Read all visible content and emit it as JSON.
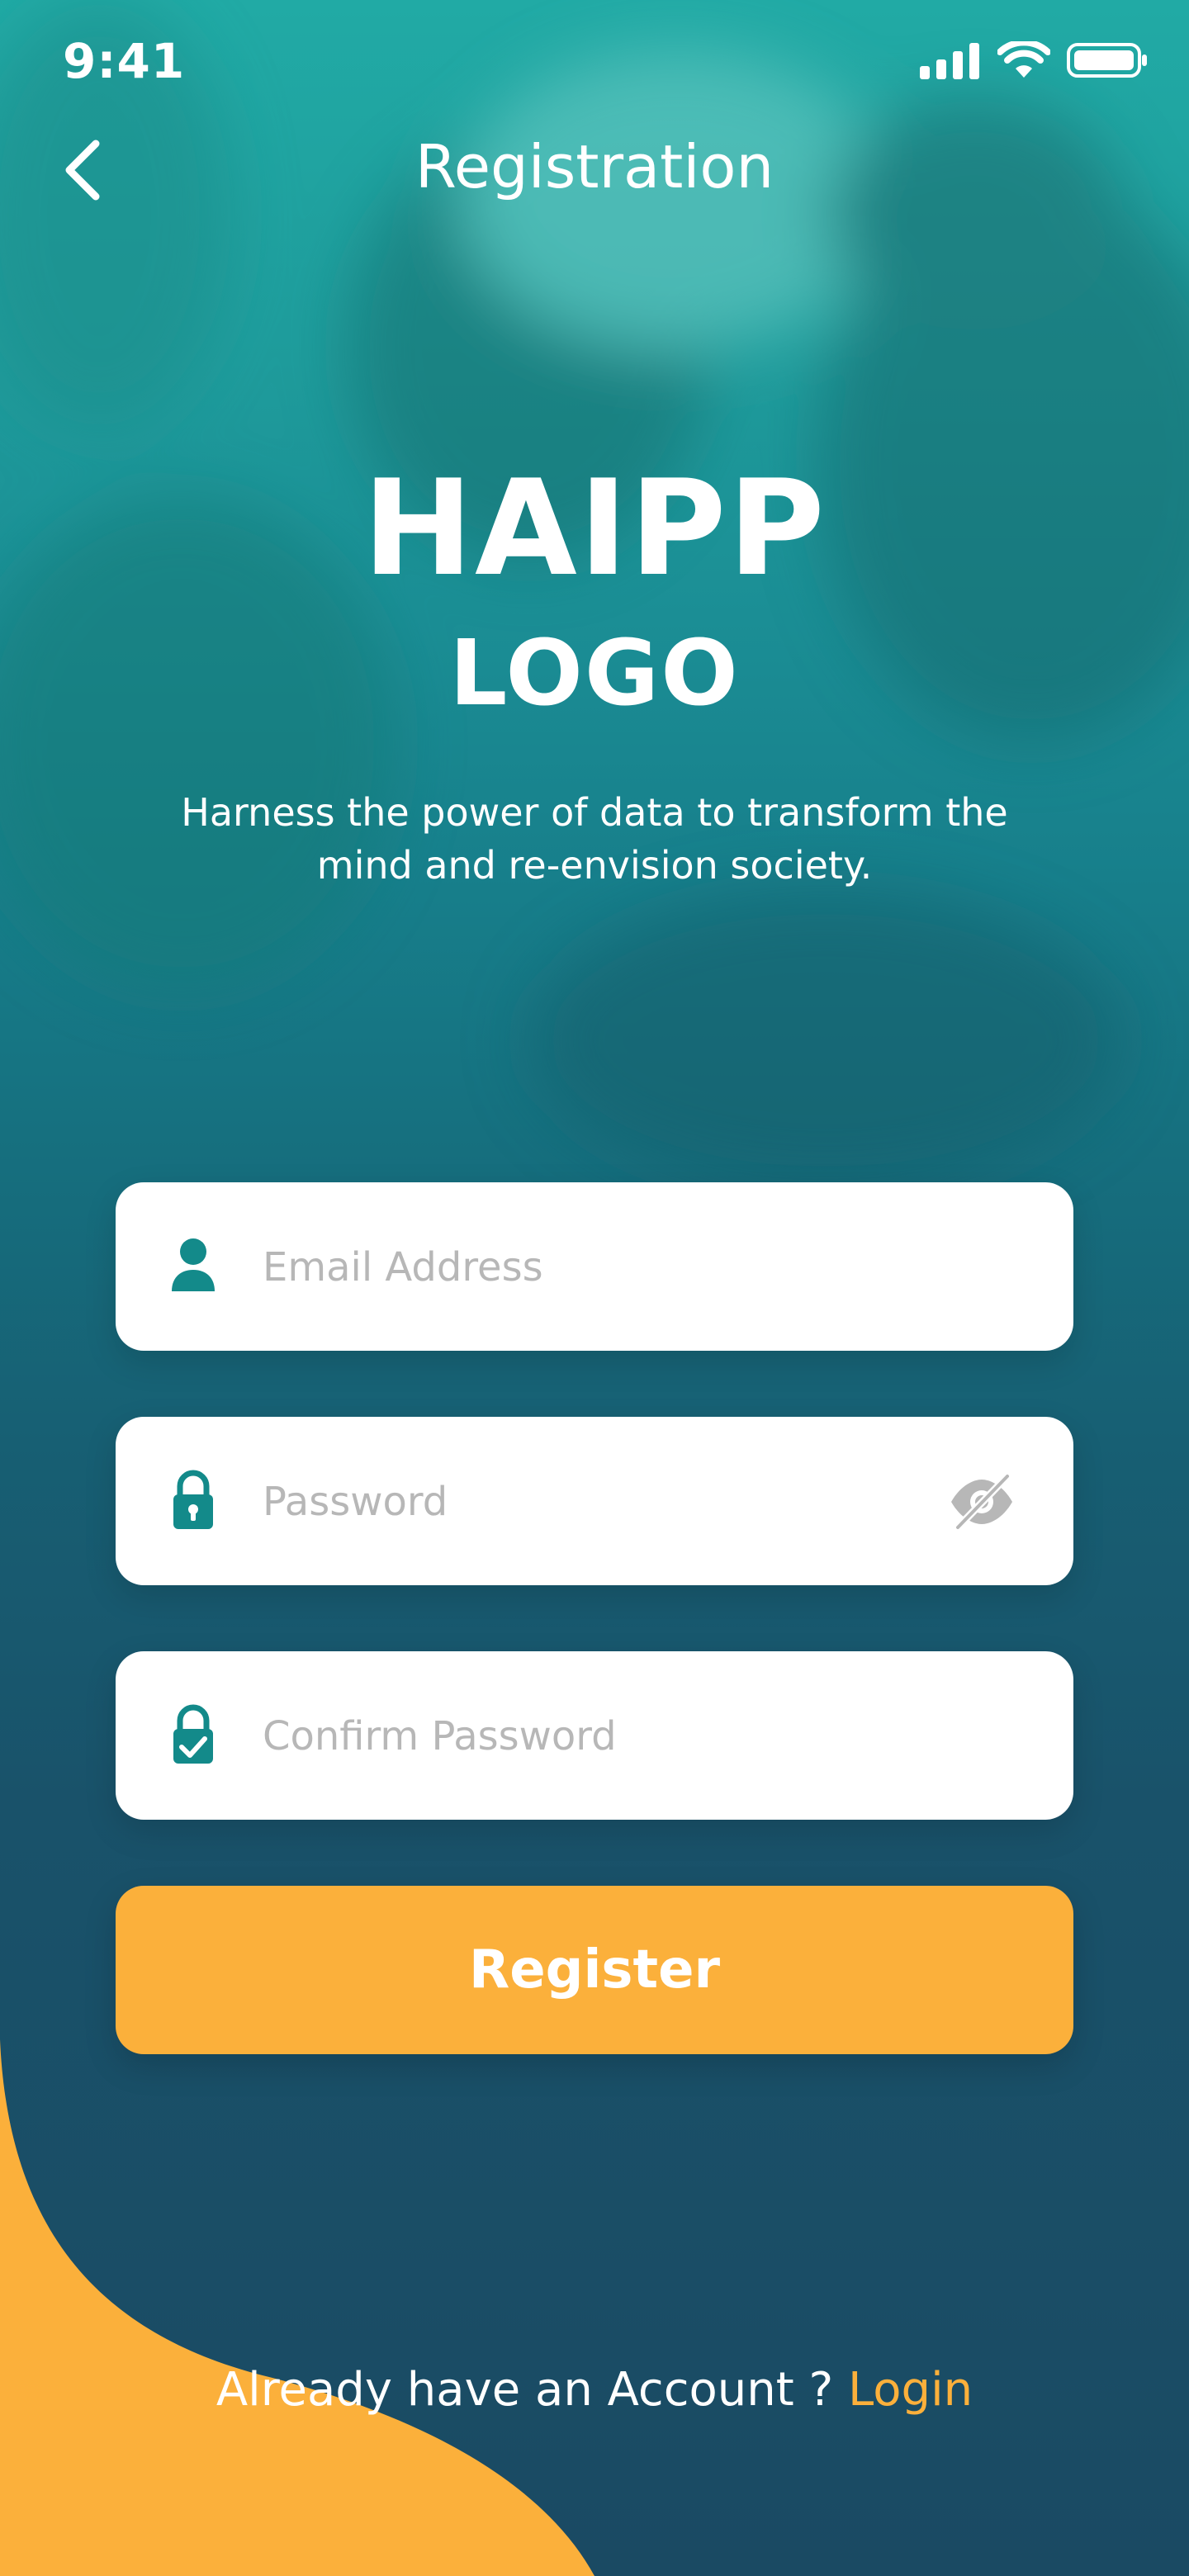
{
  "status_bar": {
    "time": "9:41",
    "icons": [
      "cellular-signal-icon",
      "wifi-icon",
      "battery-icon"
    ]
  },
  "header": {
    "back_icon": "chevron-left-icon",
    "title": "Registration"
  },
  "brand": {
    "line1": "HAIPP",
    "line2": "LOGO",
    "tagline": "Harness the power of data to transform the mind and re-envision society."
  },
  "form": {
    "email": {
      "placeholder": "Email Address",
      "value": "",
      "icon": "user-icon"
    },
    "password": {
      "placeholder": "Password",
      "value": "",
      "icon": "lock-icon",
      "toggle_icon": "eye-off-icon"
    },
    "confirm_password": {
      "placeholder": "Confirm Password",
      "value": "",
      "icon": "lock-check-icon"
    },
    "submit_label": "Register"
  },
  "footer": {
    "prompt": "Already have an Account ?",
    "link_label": "Login"
  },
  "colors": {
    "accent": "#fbb03b",
    "teal_top": "#21aaa5",
    "navy_bottom": "#1a4a63",
    "icon_teal": "#138a8a",
    "placeholder": "#b7b7b7"
  }
}
